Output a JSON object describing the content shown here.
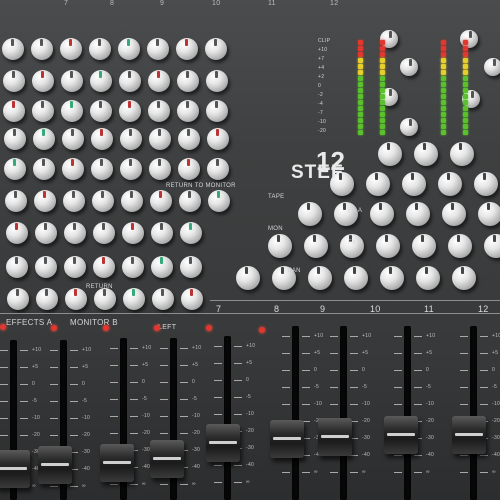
{
  "panel": {
    "model_number": "12",
    "model_name": "STEF",
    "meter_labels": [
      "CLIP",
      "+10",
      "+7",
      "+4",
      "+2",
      "0",
      "-2",
      "-4",
      "-7",
      "-10",
      "-20"
    ],
    "section_labels": {
      "return_to_mon": "RETURN TO MONITOR",
      "return": "RETURN",
      "tape": "TAPE",
      "fx_a": "FX A",
      "fx_b": "FX B",
      "mon": "MON",
      "pan": "PAN"
    },
    "bus_labels": [
      "EFFECTS A",
      "MONITOR B"
    ],
    "channel_numbers": [
      "7",
      "8",
      "9",
      "10",
      "11",
      "12"
    ],
    "top_numbers": [
      "7",
      "8",
      "9",
      "10",
      "11",
      "12"
    ],
    "fader_scale": [
      "+10",
      "+5",
      "0",
      "-5",
      "-10",
      "-20",
      "-30",
      "-40",
      "∞"
    ],
    "left_label": "LEFT"
  },
  "colors": {
    "panel": "#3e4041",
    "knob_cap": "#e6e6e6",
    "meter_red": "#e2372f",
    "meter_yellow": "#e6cf2a",
    "meter_green": "#5ac02c"
  }
}
